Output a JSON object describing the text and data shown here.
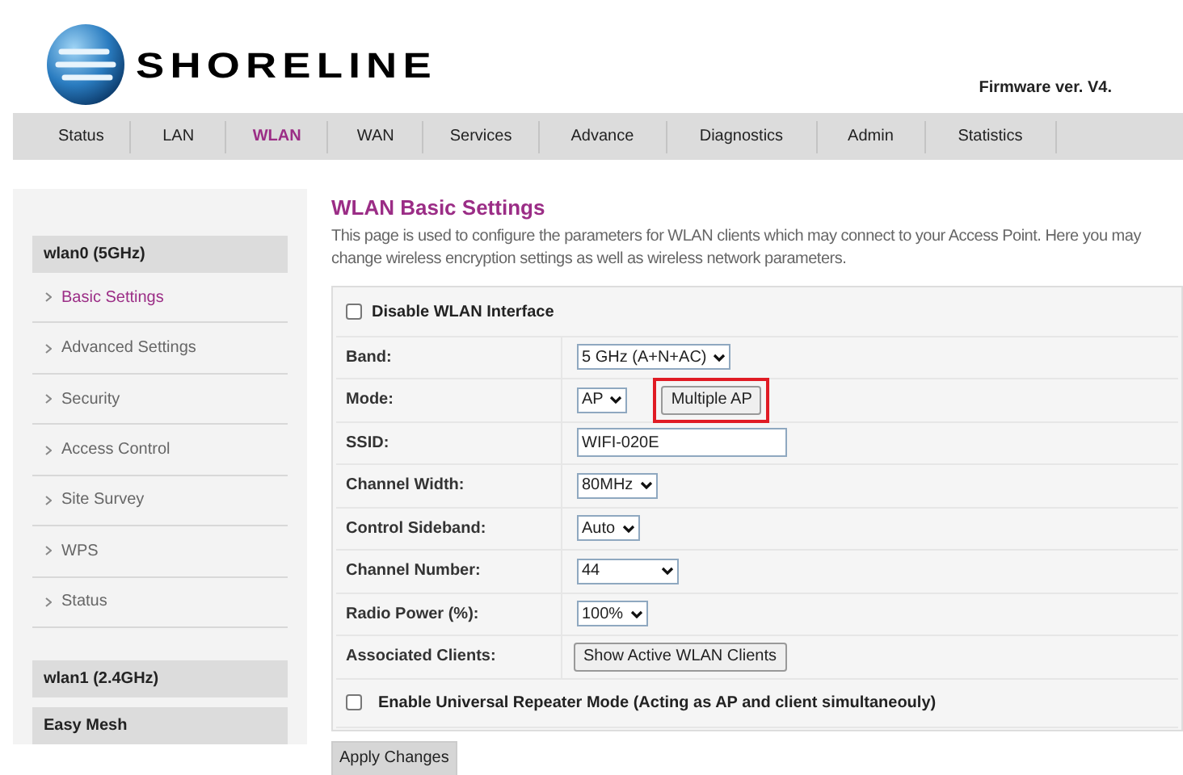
{
  "header": {
    "logo_text": "SHORELINE",
    "firmware": "Firmware ver. V4."
  },
  "nav": [
    {
      "label": "Status",
      "selected": false
    },
    {
      "label": "LAN",
      "selected": false
    },
    {
      "label": "WLAN",
      "selected": true
    },
    {
      "label": "WAN",
      "selected": false
    },
    {
      "label": "Services",
      "selected": false
    },
    {
      "label": "Advance",
      "selected": false
    },
    {
      "label": "Diagnostics",
      "selected": false
    },
    {
      "label": "Admin",
      "selected": false
    },
    {
      "label": "Statistics",
      "selected": false
    }
  ],
  "sidebar": [
    {
      "title": "wlan0 (5GHz)",
      "items": [
        {
          "label": "Basic Settings",
          "selected": true
        },
        {
          "label": "Advanced Settings",
          "selected": false
        },
        {
          "label": "Security",
          "selected": false
        },
        {
          "label": "Access Control",
          "selected": false
        },
        {
          "label": "Site Survey",
          "selected": false
        },
        {
          "label": "WPS",
          "selected": false
        },
        {
          "label": "Status",
          "selected": false
        }
      ]
    },
    {
      "title": "wlan1 (2.4GHz)"
    },
    {
      "title": "Easy Mesh"
    }
  ],
  "page": {
    "title": "WLAN Basic Settings",
    "description": "This page is used to configure the parameters for WLAN clients which may connect to your Access Point. Here you may change wireless encryption settings as well as wireless network parameters."
  },
  "form": [
    {
      "kind": "checkbox",
      "label": "Disable WLAN Interface",
      "checked": false
    },
    {
      "kind": "select",
      "label": "Band:",
      "value": "5 GHz (A+N+AC)"
    },
    {
      "kind": "select",
      "label": "Mode:",
      "value": "AP",
      "button": {
        "label": "Multiple AP",
        "highlighted": true
      }
    },
    {
      "kind": "text",
      "label": "SSID:",
      "value": "WIFI-020E"
    },
    {
      "kind": "select",
      "label": "Channel Width:",
      "value": "80MHz"
    },
    {
      "kind": "select",
      "label": "Control Sideband:",
      "value": "Auto"
    },
    {
      "kind": "select",
      "label": "Channel Number:",
      "value": "44",
      "wide": true
    },
    {
      "kind": "select",
      "label": "Radio Power (%):",
      "value": "100%"
    },
    {
      "kind": "button",
      "label": "Associated Clients:",
      "value": "Show Active WLAN Clients"
    },
    {
      "kind": "checkbox",
      "label": "Enable Universal Repeater Mode (Acting as AP and client simultaneouly)",
      "checked": false
    }
  ],
  "apply_button": "Apply Changes"
}
